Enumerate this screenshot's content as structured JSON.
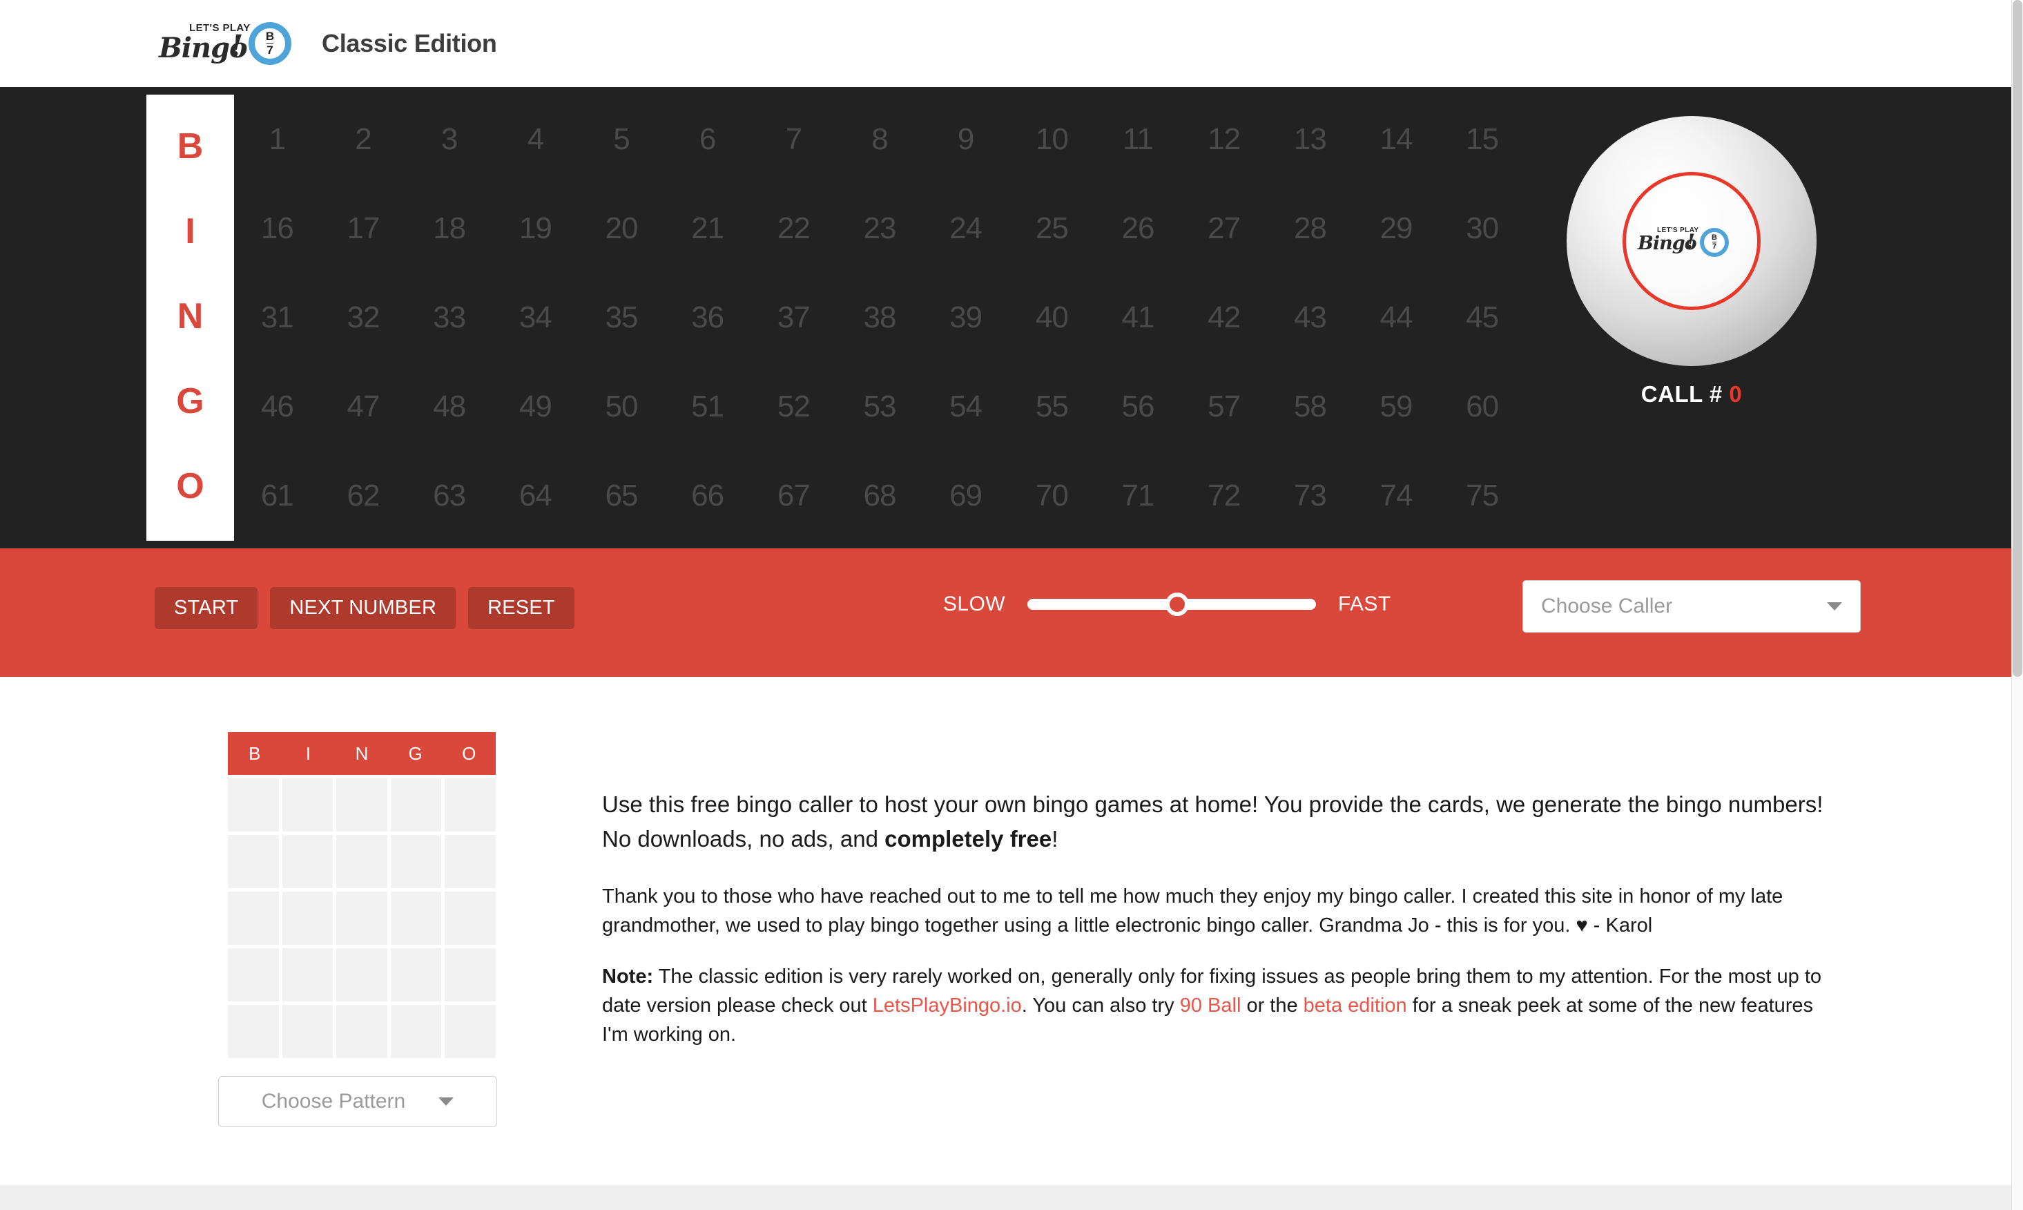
{
  "header": {
    "logo": {
      "kicker": "LET'S PLAY",
      "script": "Bingo",
      "bang": "!",
      "ball_letter": "B",
      "ball_number": "7"
    },
    "edition_title": "Classic Edition"
  },
  "board": {
    "column_letters": [
      "B",
      "I",
      "N",
      "G",
      "O"
    ],
    "numbers": [
      1,
      2,
      3,
      4,
      5,
      6,
      7,
      8,
      9,
      10,
      11,
      12,
      13,
      14,
      15,
      16,
      17,
      18,
      19,
      20,
      21,
      22,
      23,
      24,
      25,
      26,
      27,
      28,
      29,
      30,
      31,
      32,
      33,
      34,
      35,
      36,
      37,
      38,
      39,
      40,
      41,
      42,
      43,
      44,
      45,
      46,
      47,
      48,
      49,
      50,
      51,
      52,
      53,
      54,
      55,
      56,
      57,
      58,
      59,
      60,
      61,
      62,
      63,
      64,
      65,
      66,
      67,
      68,
      69,
      70,
      71,
      72,
      73,
      74,
      75
    ],
    "called_numbers": [],
    "ball": {
      "kicker": "LET'S PLAY",
      "script": "Bingo",
      "bang": "!",
      "ball_letter": "B",
      "ball_number": "7"
    },
    "call_label": "CALL #",
    "call_count": "0"
  },
  "controls": {
    "start_label": "START",
    "next_label": "NEXT NUMBER",
    "reset_label": "RESET",
    "slow_label": "SLOW",
    "fast_label": "FAST",
    "speed_value": 52,
    "caller_placeholder": "Choose Caller"
  },
  "pattern": {
    "column_letters": [
      "B",
      "I",
      "N",
      "G",
      "O"
    ],
    "cells": [
      "",
      "",
      "",
      "",
      "",
      "",
      "",
      "",
      "",
      "",
      "",
      "",
      "",
      "",
      "",
      "",
      "",
      "",
      "",
      "",
      "",
      "",
      "",
      "",
      ""
    ],
    "select_placeholder": "Choose Pattern"
  },
  "copy": {
    "p1_a": "Use this free bingo caller to host your own bingo games at home! You provide the cards, we generate the bingo numbers! No downloads, no ads, and ",
    "p1_bold": "completely free",
    "p1_b": "!",
    "p2": "Thank you to those who have reached out to me to tell me how much they enjoy my bingo caller. I created this site in honor of my late grandmother, we used to play bingo together using a little electronic bingo caller. Grandma Jo - this is for you. ♥ - Karol",
    "p3_note": "Note:",
    "p3_a": " The classic edition is very rarely worked on, generally only for fixing issues as people bring them to my attention. For the most up to date version please check out ",
    "p3_link1": "LetsPlayBingo.io",
    "p3_b": ". You can also try ",
    "p3_link2": "90 Ball",
    "p3_c": " or the ",
    "p3_link3": "beta edition",
    "p3_d": " for a sneak peek at some of the new features I'm working on."
  },
  "colors": {
    "accent_red": "#d9483b",
    "button_red": "#ae3a2e",
    "link_red": "#e8564a",
    "board_dark": "#222222",
    "ball_ring_red": "#e8382a"
  }
}
